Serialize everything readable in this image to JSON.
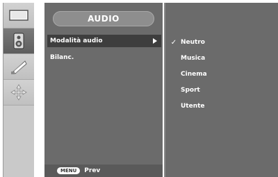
{
  "menu": {
    "title": "AUDIO",
    "items": [
      {
        "label": "Modalità audio",
        "selected": true,
        "has_submenu": true
      },
      {
        "label": "Bilanc.",
        "selected": false,
        "has_submenu": false
      }
    ]
  },
  "submenu": {
    "options": [
      {
        "label": "Neutro",
        "checked": true,
        "check_mark": "✓"
      },
      {
        "label": "Musica",
        "checked": false,
        "check_mark": ""
      },
      {
        "label": "Cinema",
        "checked": false,
        "check_mark": ""
      },
      {
        "label": "Sport",
        "checked": false,
        "check_mark": ""
      },
      {
        "label": "Utente",
        "checked": false,
        "check_mark": ""
      }
    ]
  },
  "footer": {
    "key_label": "MENU",
    "action_label": "Prev"
  },
  "sidebar": {
    "icons": [
      {
        "name": "picture-icon",
        "active": false
      },
      {
        "name": "speaker-icon",
        "active": true
      },
      {
        "name": "satellite-dish-icon",
        "active": false
      },
      {
        "name": "setup-arrows-icon",
        "active": false
      }
    ]
  },
  "colors": {
    "panel": "#6b6b6b",
    "selected_row": "#3e3e3e",
    "sidebar": "#c9c9c9",
    "text": "#ffffff"
  }
}
